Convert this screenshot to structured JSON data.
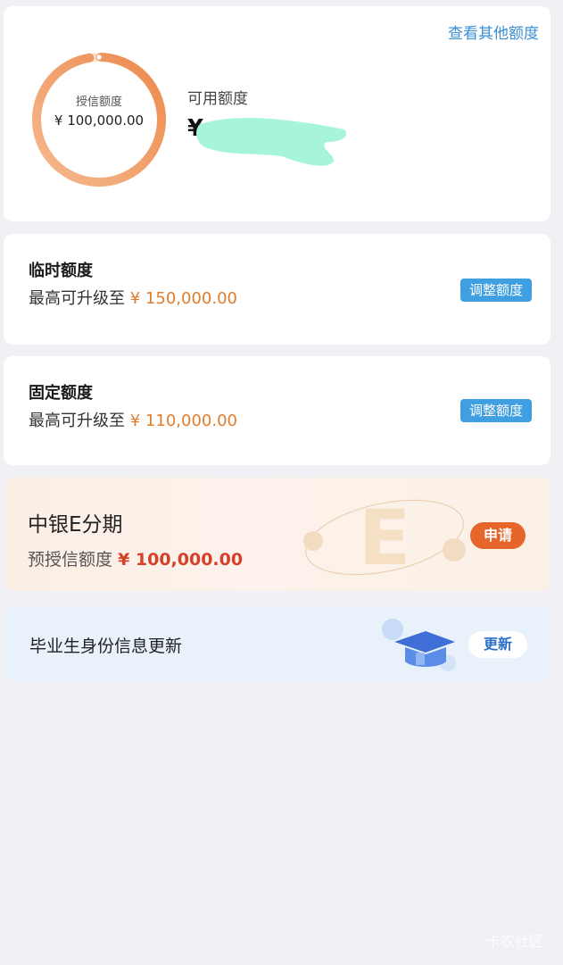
{
  "overview": {
    "other_link": "查看其他额度",
    "ring_label": "授信额度",
    "ring_value": "¥ 100,000.00",
    "ring_progress": 0.97,
    "available_label": "可用额度",
    "available_value": "¥",
    "colors": {
      "ring": "#ef9a5e",
      "ring_track": "#fbe6d6",
      "redaction": "#a6f5d8"
    }
  },
  "temp_limit": {
    "title": "临时额度",
    "sub_prefix": "最高可升级至",
    "amount": "¥ 150,000.00",
    "button": "调整额度"
  },
  "fixed_limit": {
    "title": "固定额度",
    "sub_prefix": "最高可升级至",
    "amount": "¥ 110,000.00",
    "button": "调整额度"
  },
  "installment": {
    "title": "中银E分期",
    "sub_prefix": "预授信额度",
    "amount": "¥ 100,000.00",
    "button": "申请",
    "deco_letter": "E"
  },
  "graduate": {
    "title": "毕业生身份信息更新",
    "button": "更新"
  },
  "watermark": "卡农社区",
  "colors": {
    "accent_blue": "#3f9fe0",
    "accent_orange": "#e07d2c",
    "apply_orange": "#e5652a",
    "amount_red": "#d6402a"
  }
}
